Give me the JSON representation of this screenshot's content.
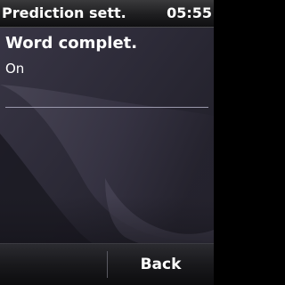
{
  "status_bar": {
    "title": "Prediction sett.",
    "time": "05:55"
  },
  "setting": {
    "label": "Word complet.",
    "value": "On"
  },
  "softkeys": {
    "left_label": "",
    "right_label": "Back"
  },
  "colors": {
    "wallpaper_base": "#2e2b38",
    "text": "#ffffff",
    "divider": "#9a98ac"
  }
}
